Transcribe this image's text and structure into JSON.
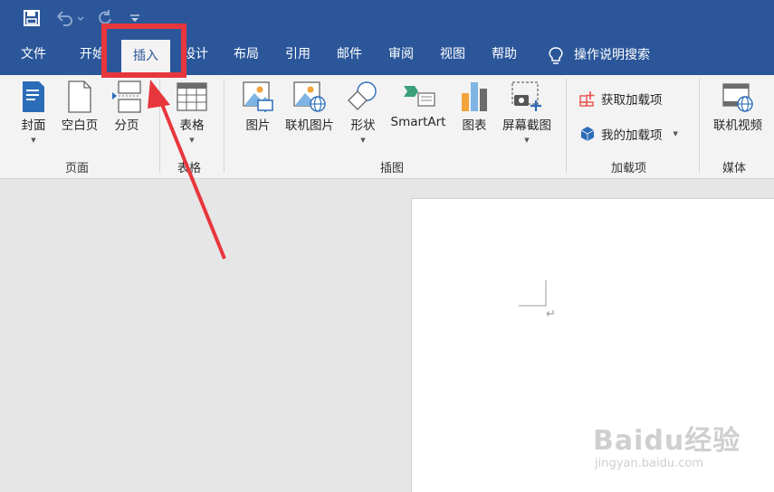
{
  "quick_access": {
    "save_icon": "save-icon",
    "undo_icon": "undo-icon",
    "redo_icon": "redo-icon",
    "customize_icon": "customize-icon"
  },
  "tabs": [
    {
      "label": "文件"
    },
    {
      "label": "开始"
    },
    {
      "label": "插入"
    },
    {
      "label": "设计"
    },
    {
      "label": "布局"
    },
    {
      "label": "引用"
    },
    {
      "label": "邮件"
    },
    {
      "label": "审阅"
    },
    {
      "label": "视图"
    },
    {
      "label": "帮助"
    }
  ],
  "tell_me": {
    "label": "操作说明搜索",
    "icon": "lightbulb-icon"
  },
  "ribbon": {
    "groups": {
      "pages": "页面",
      "tables": "表格",
      "illustrations": "插图",
      "addins": "加载项",
      "media": "媒体"
    },
    "buttons": {
      "cover": "封面",
      "blank_page": "空白页",
      "page_break": "分页",
      "table": "表格",
      "picture": "图片",
      "online_picture": "联机图片",
      "shapes": "形状",
      "smartart": "SmartArt",
      "chart": "图表",
      "screenshot": "屏幕截图",
      "get_addins": "获取加载项",
      "my_addins": "我的加载项",
      "online_video": "联机视频"
    }
  },
  "document": {
    "paragraph_mark": "↵"
  },
  "annotation": {
    "highlight_color": "#e8363d",
    "arrow_color": "#e8363d"
  },
  "watermark": {
    "text": "Baidu经验",
    "subtext": "jingyan.baidu.com"
  },
  "colors": {
    "title_bar": "#2b579a",
    "ribbon_bg": "#f3f3f3",
    "doc_bg": "#e6e6e6"
  }
}
